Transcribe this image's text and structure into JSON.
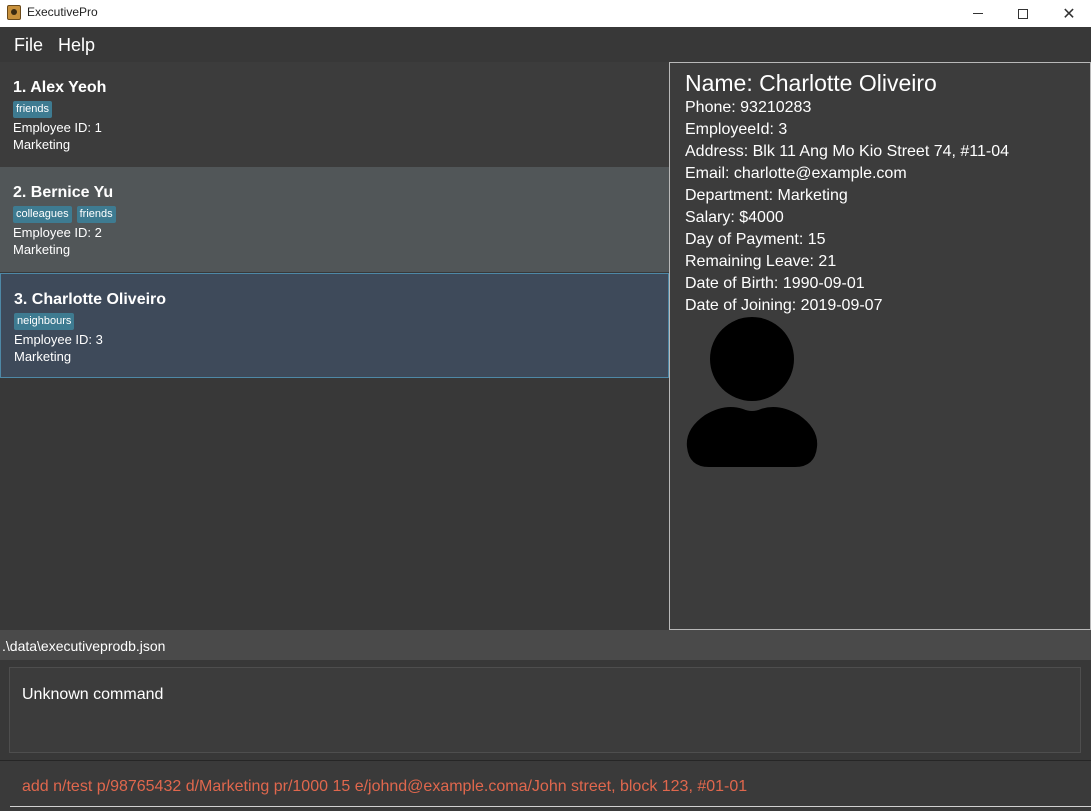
{
  "window": {
    "title": "ExecutivePro",
    "minimize_glyph": "—",
    "maximize_glyph": "☐",
    "close_glyph": "✕"
  },
  "menu": {
    "file": "File",
    "help": "Help"
  },
  "persons": [
    {
      "name": "1.  Alex Yeoh",
      "tags": [
        "friends"
      ],
      "employee_id": "Employee ID: 1",
      "department": "Marketing"
    },
    {
      "name": "2.  Bernice Yu",
      "tags": [
        "colleagues",
        "friends"
      ],
      "employee_id": "Employee ID: 2",
      "department": "Marketing"
    },
    {
      "name": "3.  Charlotte Oliveiro",
      "tags": [
        "neighbours"
      ],
      "employee_id": "Employee ID: 3",
      "department": "Marketing"
    }
  ],
  "detail": {
    "name": "Name: Charlotte Oliveiro",
    "phone": "Phone: 93210283",
    "employee_id": "EmployeeId: 3",
    "address": "Address: Blk 11 Ang Mo Kio Street 74, #11-04",
    "email": "Email: charlotte@example.com",
    "department": "Department: Marketing",
    "salary": "Salary: $4000",
    "day_of_payment": "Day of Payment: 15",
    "remaining_leave": "Remaining Leave: 21",
    "date_of_birth": "Date of Birth: 1990-09-01",
    "date_of_joining": "Date of Joining: 2019-09-07",
    "avatar_icon": "person-silhouette-icon"
  },
  "status": {
    "path": ".\\data\\executiveprodb.json"
  },
  "result": {
    "text": "Unknown command"
  },
  "command": {
    "value": "add n/test p/98765432 d/Marketing pr/1000 15 e/johnd@example.coma/John street, block 123, #01-01"
  },
  "colors": {
    "tag_bg": "#3e7b91",
    "selected_card_bg": "#3e4a5a",
    "selected_card_border": "#4e88a6",
    "command_error_text": "#e0674d"
  }
}
